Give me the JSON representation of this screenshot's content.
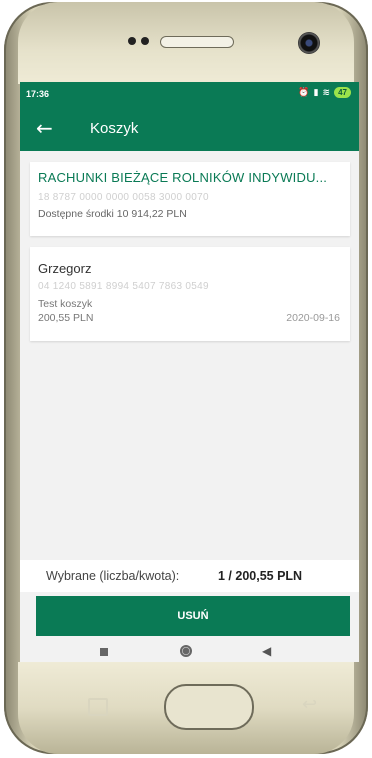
{
  "status_bar": {
    "time": "17:36",
    "alarm_icon": "alarm-icon",
    "signal_icon": "signal-icon",
    "wifi_icon": "wifi-icon",
    "battery": "47"
  },
  "app_bar": {
    "title": "Koszyk",
    "back_icon": "back-arrow-icon"
  },
  "account": {
    "name": "RACHUNKI BIEŻĄCE ROLNIKÓW INDYWIDU...",
    "number": "18 8787 0000 0000 0058 3000 0070",
    "funds": "Dostępne środki 10 914,22 PLN"
  },
  "transfer": {
    "recipient": "Grzegorz",
    "account": "04 1240 5891 8994 5407 7863 0549",
    "title": "Test koszyk",
    "amount": "200,55 PLN",
    "date": "2020-09-16"
  },
  "summary": {
    "label": "Wybrane (liczba/kwota):",
    "value": "1 / 200,55 PLN"
  },
  "actions": {
    "delete_label": "USUŃ"
  },
  "colors": {
    "brand": "#0a7a55",
    "battery": "#9be34b"
  }
}
